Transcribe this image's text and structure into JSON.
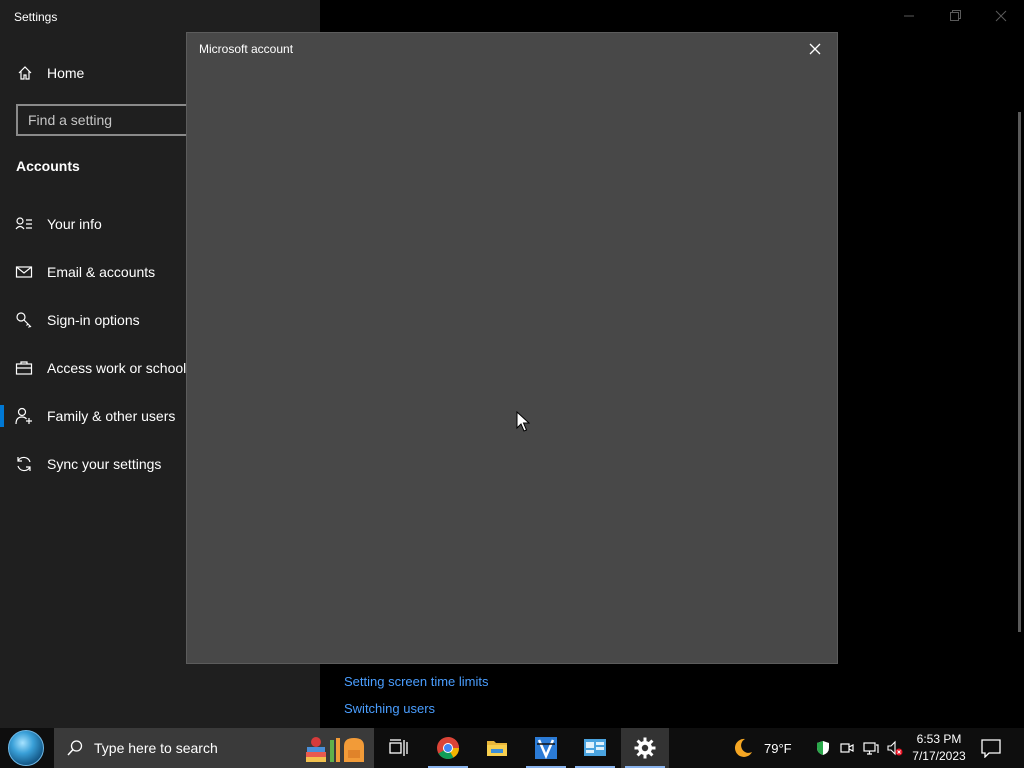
{
  "window": {
    "title": "Settings",
    "controls": {
      "minimize": "minimize-icon",
      "restore": "restore-icon",
      "close": "close-icon"
    }
  },
  "sidebar": {
    "home_label": "Home",
    "search_placeholder": "Find a setting",
    "section_title": "Accounts",
    "items": [
      {
        "label": "Your info",
        "icon": "person-card-icon",
        "active": false
      },
      {
        "label": "Email & accounts",
        "icon": "mail-icon",
        "active": false
      },
      {
        "label": "Sign-in options",
        "icon": "key-icon",
        "active": false
      },
      {
        "label": "Access work or school",
        "icon": "briefcase-icon",
        "active": false
      },
      {
        "label": "Family & other users",
        "icon": "person-add-icon",
        "active": true
      },
      {
        "label": "Sync your settings",
        "icon": "sync-icon",
        "active": false
      }
    ]
  },
  "main": {
    "links": [
      "Setting screen time limits",
      "Switching users"
    ]
  },
  "dialog": {
    "title": "Microsoft account"
  },
  "taskbar": {
    "search_placeholder": "Type here to search",
    "apps": [
      {
        "name": "task-view",
        "icon": "task-view-icon"
      },
      {
        "name": "chrome",
        "icon": "chrome-icon"
      },
      {
        "name": "file-explorer",
        "icon": "folder-icon"
      },
      {
        "name": "app-blue",
        "icon": "app-icon"
      },
      {
        "name": "control-panel",
        "icon": "control-panel-icon"
      },
      {
        "name": "settings",
        "icon": "gear-icon"
      }
    ],
    "weather": {
      "temp": "79°F",
      "icon": "moon-icon"
    },
    "clock": {
      "time": "6:53 PM",
      "date": "7/17/2023"
    }
  },
  "colors": {
    "accent": "#0078d4",
    "link": "#4a9eff",
    "sidebar_bg": "#1f1f1f",
    "dialog_bg": "#484848",
    "taskbar_bg": "#0e0e0e"
  }
}
